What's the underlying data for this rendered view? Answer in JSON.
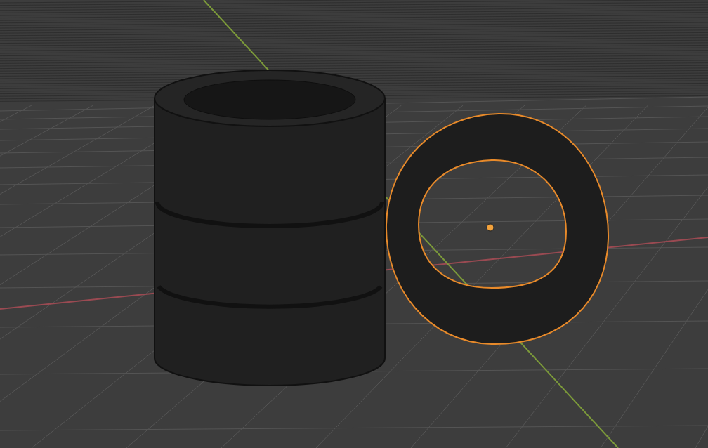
{
  "viewport": {
    "objects": [
      {
        "kind": "tire-stack",
        "selected": false
      },
      {
        "kind": "tire",
        "selected": true
      }
    ]
  }
}
